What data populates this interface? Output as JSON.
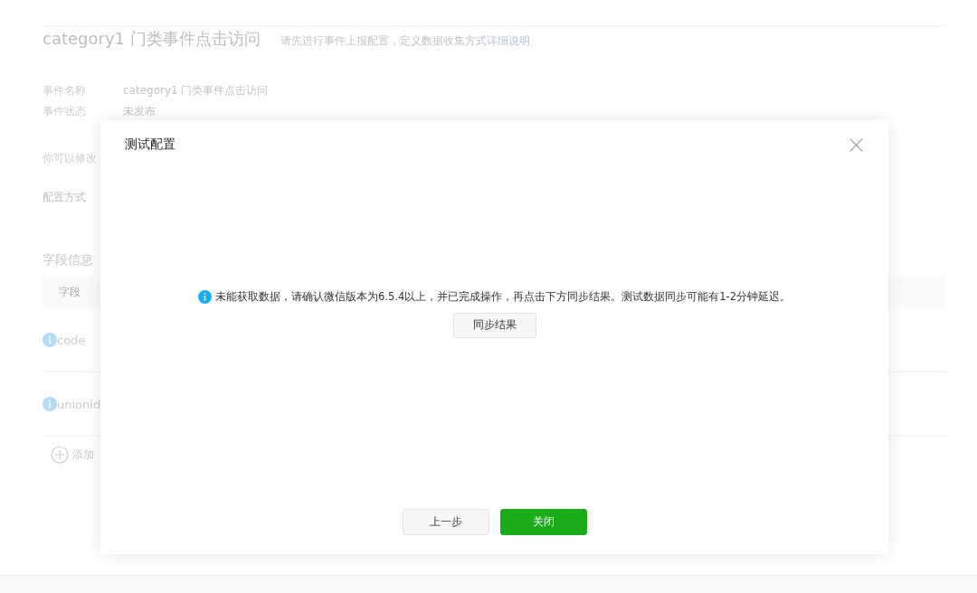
{
  "page": {
    "title": "category1 门类事件点击访问",
    "hint": "请先进行事件上报配置，定义数据收集方式",
    "hint_link": "详细说明",
    "info": [
      {
        "label": "事件名称",
        "value": "category1 门类事件点击访问"
      },
      {
        "label": "事件状态",
        "value": "未发布"
      }
    ],
    "note": "你可以修改",
    "config_label": "配置方式",
    "fields_title": "字段信息",
    "table_header": "字段",
    "fields": [
      {
        "name": "code"
      },
      {
        "name": "unionid"
      }
    ],
    "add_label": "添加"
  },
  "dialog": {
    "title": "测试配置",
    "message": "未能获取数据，请确认微信版本为6.5.4以上，并已完成操作，再点击下方同步结果。测试数据同步可能有1-2分钟延迟。",
    "sync_button": "同步结果",
    "buttons": [
      {
        "label": "上一步",
        "kind": "default"
      },
      {
        "label": "关闭",
        "kind": "primary"
      }
    ]
  }
}
